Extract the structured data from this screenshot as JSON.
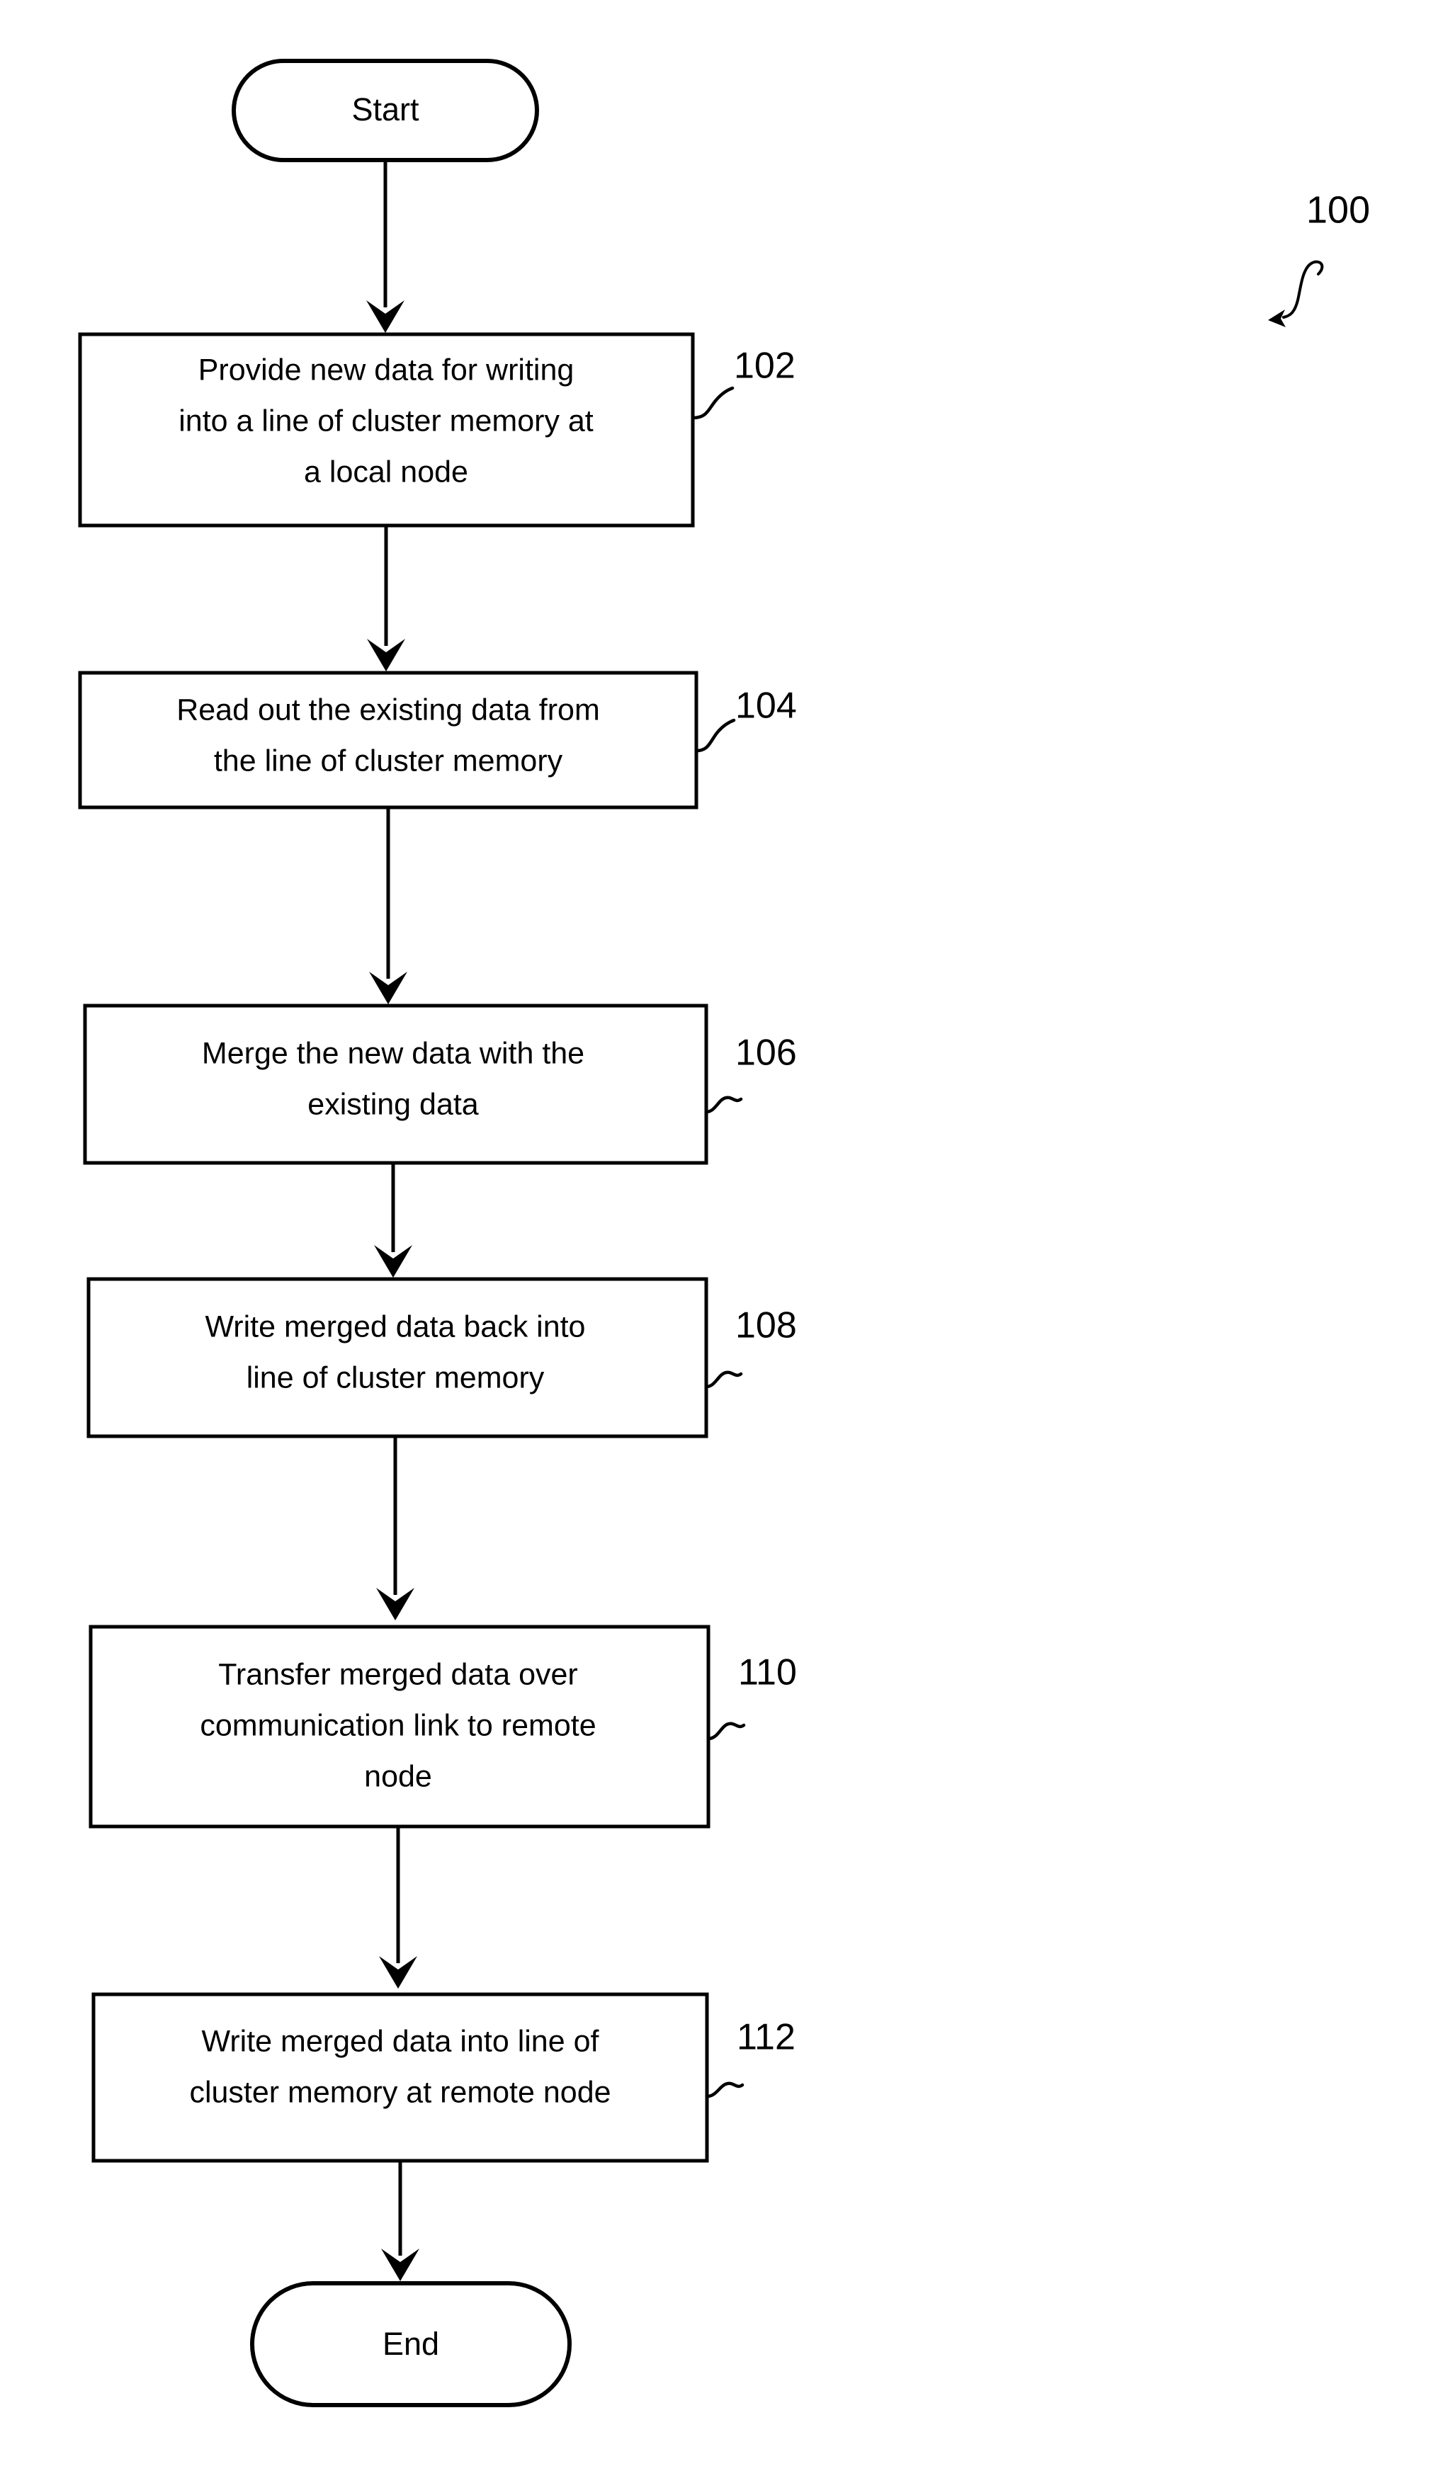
{
  "figure": {
    "number": "100",
    "type": "flowchart"
  },
  "terminators": {
    "start": {
      "label": "Start"
    },
    "end": {
      "label": "End"
    }
  },
  "steps": [
    {
      "ref": "102",
      "lines": [
        "Provide new data for writing",
        "into a line of cluster memory at",
        "a local node"
      ]
    },
    {
      "ref": "104",
      "lines": [
        "Read out the existing data from",
        "the line of cluster memory"
      ]
    },
    {
      "ref": "106",
      "lines": [
        "Merge the new data with the",
        "existing data"
      ]
    },
    {
      "ref": "108",
      "lines": [
        "Write merged data back into",
        "line of cluster memory"
      ]
    },
    {
      "ref": "110",
      "lines": [
        "Transfer merged data over",
        "communication link to remote",
        "node"
      ]
    },
    {
      "ref": "112",
      "lines": [
        "Write merged data into line of",
        "cluster memory at remote node"
      ]
    }
  ],
  "colors": {
    "ink": "#000000",
    "paper": "#ffffff"
  }
}
